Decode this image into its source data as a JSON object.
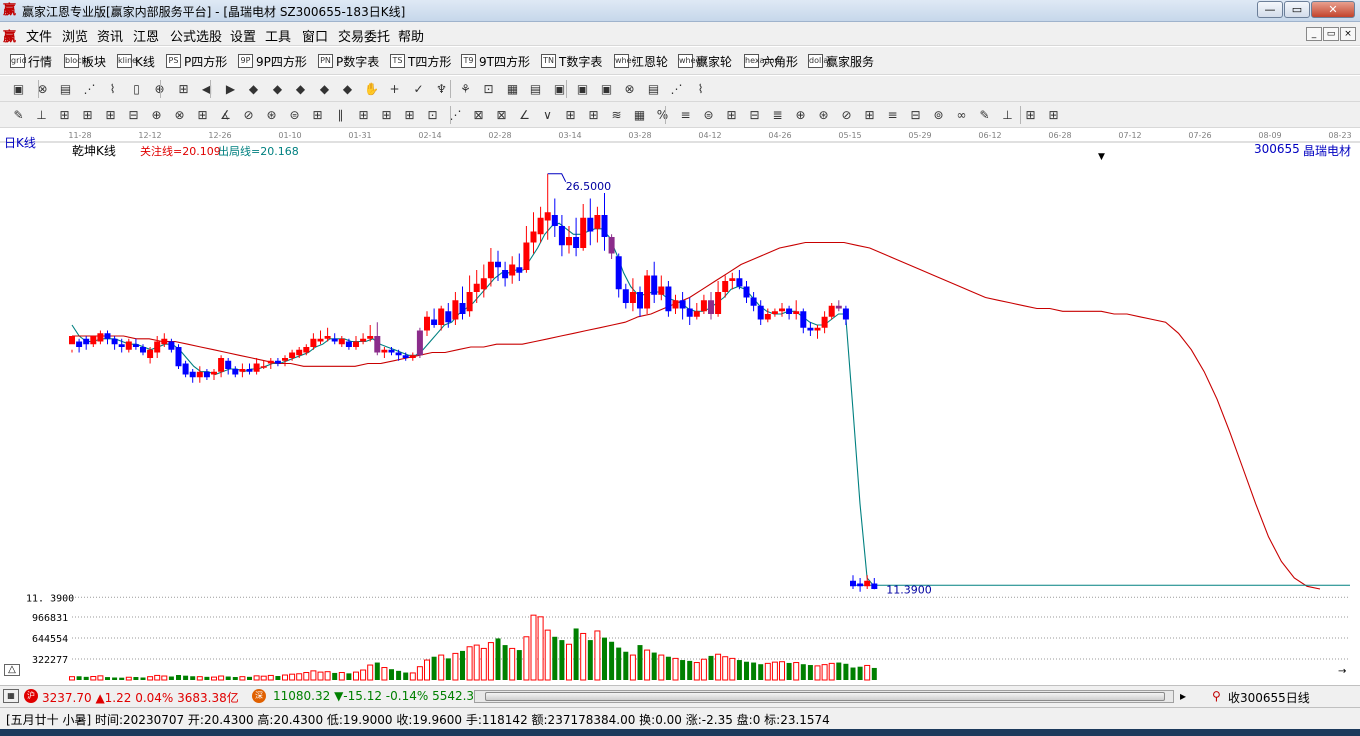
{
  "window": {
    "title": "赢家江恩专业版[赢家内部服务平台] - [晶瑞电材  SZ300655-183日K线]",
    "icon": "ying-app-icon",
    "app_icon_char": "赢",
    "min": "—",
    "restore": "▭",
    "close": "✕"
  },
  "menubar": {
    "items": [
      "文件",
      "浏览",
      "资讯",
      "江恩",
      "公式选股",
      "设置",
      "工具",
      "窗口",
      "交易委托",
      "帮助"
    ],
    "mdi": [
      "_",
      "▭",
      "×"
    ]
  },
  "toolbar1": {
    "items": [
      {
        "label": "行情",
        "icon": "grid"
      },
      {
        "label": "板块",
        "icon": "blocks"
      },
      {
        "label": "K线",
        "icon": "kline"
      },
      {
        "label": "P四方形",
        "icon": "PS"
      },
      {
        "label": "9P四方形",
        "icon": "9P"
      },
      {
        "label": "P数字表",
        "icon": "PN"
      },
      {
        "label": "T四方形",
        "icon": "TS"
      },
      {
        "label": "9T四方形",
        "icon": "T9"
      },
      {
        "label": "T数字表",
        "icon": "TN"
      },
      {
        "label": "江恩轮",
        "icon": "wheel"
      },
      {
        "label": "赢家轮",
        "icon": "wheel2"
      },
      {
        "label": "六角形",
        "icon": "hexagon"
      },
      {
        "label": "赢家服务",
        "icon": "dollar"
      }
    ]
  },
  "chart_header": {
    "period": "日K线",
    "indicator": "乾坤K线",
    "guan_zhu": "关注线=20.109",
    "chu_ju": "出局线=20.168",
    "code": "300655",
    "name": "晶瑞电材"
  },
  "date_axis": [
    "11-28",
    "12-12",
    "12-26",
    "01-10",
    "01-31",
    "02-14",
    "02-28",
    "03-14",
    "03-28",
    "04-12",
    "04-26",
    "05-15",
    "05-29",
    "06-12",
    "06-28",
    "07-12",
    "07-26",
    "08-09",
    "08-23"
  ],
  "price_labels": {
    "high": "26.5000",
    "low": "11.3900",
    "left_low": "11. 3900"
  },
  "volume_axis": [
    "966831",
    "644554",
    "322277"
  ],
  "colors": {
    "up": "#ff0000",
    "down": "#0000ff",
    "special": "#8b2c8b",
    "ma_fast": "#008080",
    "ma_slow": "#c80000",
    "vol_up": "#ff0000",
    "vol_down": "#008000"
  },
  "chart_data": {
    "type": "candlestick",
    "title": "乾坤K线",
    "ylim": [
      11.0,
      27.0
    ],
    "candles": [
      [
        20.3,
        20.6,
        20.1,
        20.0
      ],
      [
        20.4,
        20.2,
        20.0,
        20.5
      ],
      [
        20.5,
        20.3,
        20.1,
        20.6
      ],
      [
        20.3,
        20.6,
        20.2,
        20.6
      ],
      [
        20.4,
        20.7,
        20.3,
        20.8
      ],
      [
        20.7,
        20.5,
        20.3,
        20.8
      ],
      [
        20.5,
        20.3,
        20.1,
        20.6
      ],
      [
        20.3,
        20.2,
        20.0,
        20.5
      ],
      [
        20.1,
        20.4,
        20.0,
        20.5
      ],
      [
        20.3,
        20.2,
        20.1,
        20.5
      ],
      [
        20.2,
        20.0,
        19.9,
        20.3
      ],
      [
        19.8,
        20.1,
        19.6,
        20.2
      ],
      [
        20.0,
        20.4,
        19.8,
        20.6
      ],
      [
        20.3,
        20.5,
        20.2,
        20.7
      ],
      [
        20.4,
        20.1,
        20.0,
        20.5
      ],
      [
        20.2,
        19.5,
        19.4,
        20.3
      ],
      [
        19.6,
        19.2,
        19.1,
        19.7
      ],
      [
        19.3,
        19.1,
        18.9,
        19.4
      ],
      [
        19.1,
        19.3,
        18.9,
        19.5
      ],
      [
        19.3,
        19.1,
        19.0,
        19.4
      ],
      [
        19.2,
        19.3,
        19.0,
        19.4
      ],
      [
        19.3,
        19.8,
        19.1,
        19.9
      ],
      [
        19.7,
        19.4,
        19.2,
        19.8
      ],
      [
        19.4,
        19.2,
        19.1,
        19.5
      ],
      [
        19.3,
        19.4,
        19.1,
        19.6
      ],
      [
        19.4,
        19.3,
        19.2,
        19.6
      ],
      [
        19.3,
        19.6,
        19.2,
        19.8
      ],
      [
        19.5,
        19.5,
        19.4,
        19.7
      ],
      [
        19.6,
        19.7,
        19.4,
        19.8
      ],
      [
        19.7,
        19.6,
        19.5,
        19.8
      ],
      [
        19.7,
        19.8,
        19.5,
        19.9
      ],
      [
        19.8,
        20.0,
        19.7,
        20.1
      ],
      [
        19.9,
        20.1,
        19.8,
        20.2
      ],
      [
        20.0,
        20.2,
        19.9,
        20.3
      ],
      [
        20.2,
        20.5,
        20.1,
        20.7
      ],
      [
        20.4,
        20.5,
        20.3,
        20.8
      ],
      [
        20.5,
        20.6,
        20.4,
        20.9
      ],
      [
        20.5,
        20.4,
        20.3,
        20.7
      ],
      [
        20.3,
        20.5,
        20.2,
        20.6
      ],
      [
        20.4,
        20.2,
        20.1,
        20.5
      ],
      [
        20.2,
        20.4,
        20.1,
        20.6
      ],
      [
        20.4,
        20.5,
        20.3,
        20.7
      ],
      [
        20.5,
        20.6,
        20.4,
        21.0
      ],
      [
        20.6,
        20.0,
        19.9,
        21.1
      ],
      [
        20.0,
        20.1,
        19.8,
        20.2
      ],
      [
        20.1,
        20.0,
        19.9,
        20.2
      ],
      [
        20.0,
        19.9,
        19.7,
        20.1
      ],
      [
        19.9,
        19.8,
        19.7,
        20.0
      ],
      [
        19.8,
        19.9,
        19.7,
        20.0
      ],
      [
        19.9,
        20.8,
        19.8,
        20.9
      ],
      [
        20.8,
        21.3,
        20.6,
        21.5
      ],
      [
        21.2,
        21.0,
        20.9,
        21.6
      ],
      [
        21.0,
        21.6,
        20.8,
        21.7
      ],
      [
        21.5,
        21.1,
        20.9,
        21.8
      ],
      [
        21.2,
        21.9,
        21.0,
        22.2
      ],
      [
        21.8,
        21.4,
        21.2,
        22.4
      ],
      [
        21.5,
        22.2,
        21.3,
        22.8
      ],
      [
        22.2,
        22.5,
        21.8,
        23.0
      ],
      [
        22.3,
        22.7,
        22.0,
        23.2
      ],
      [
        22.7,
        23.3,
        22.4,
        23.8
      ],
      [
        23.3,
        23.1,
        22.6,
        23.7
      ],
      [
        23.0,
        22.7,
        22.4,
        23.3
      ],
      [
        22.8,
        23.2,
        22.5,
        23.5
      ],
      [
        23.1,
        22.9,
        22.6,
        23.6
      ],
      [
        23.0,
        24.0,
        22.9,
        24.6
      ],
      [
        24.0,
        24.4,
        23.6,
        25.1
      ],
      [
        24.3,
        24.9,
        24.0,
        25.3
      ],
      [
        24.8,
        25.1,
        24.1,
        26.5
      ],
      [
        25.0,
        24.6,
        24.2,
        25.6
      ],
      [
        24.6,
        23.9,
        23.5,
        25.0
      ],
      [
        23.9,
        24.2,
        23.6,
        24.6
      ],
      [
        24.2,
        23.8,
        23.5,
        24.9
      ],
      [
        23.8,
        24.9,
        23.7,
        25.4
      ],
      [
        24.9,
        24.4,
        23.9,
        25.6
      ],
      [
        24.5,
        25.0,
        24.0,
        25.3
      ],
      [
        25.0,
        24.2,
        23.7,
        25.8
      ],
      [
        24.2,
        23.6,
        23.4,
        24.3
      ],
      [
        23.5,
        22.3,
        22.0,
        23.6
      ],
      [
        22.3,
        21.8,
        21.6,
        22.5
      ],
      [
        21.8,
        22.2,
        21.5,
        22.7
      ],
      [
        22.2,
        21.6,
        21.3,
        22.4
      ],
      [
        21.6,
        22.8,
        21.4,
        23.0
      ],
      [
        22.8,
        22.1,
        21.8,
        23.3
      ],
      [
        22.1,
        22.4,
        21.9,
        22.8
      ],
      [
        22.4,
        21.5,
        21.3,
        22.6
      ],
      [
        21.6,
        21.9,
        21.4,
        22.1
      ],
      [
        21.9,
        21.6,
        21.2,
        22.2
      ],
      [
        21.6,
        21.3,
        21.0,
        22.0
      ],
      [
        21.3,
        21.5,
        21.2,
        21.8
      ],
      [
        21.5,
        21.9,
        21.4,
        22.1
      ],
      [
        21.9,
        21.4,
        21.2,
        22.2
      ],
      [
        21.4,
        22.2,
        21.3,
        22.6
      ],
      [
        22.2,
        22.6,
        22.0,
        22.8
      ],
      [
        22.6,
        22.7,
        22.3,
        22.9
      ],
      [
        22.7,
        22.4,
        22.3,
        23.0
      ],
      [
        22.4,
        22.0,
        21.8,
        22.6
      ],
      [
        22.0,
        21.7,
        21.5,
        22.2
      ],
      [
        21.7,
        21.2,
        21.0,
        21.9
      ],
      [
        21.2,
        21.4,
        21.1,
        21.6
      ],
      [
        21.4,
        21.5,
        21.3,
        21.6
      ],
      [
        21.5,
        21.6,
        21.3,
        21.8
      ],
      [
        21.6,
        21.4,
        21.2,
        21.7
      ],
      [
        21.4,
        21.5,
        21.2,
        21.9
      ],
      [
        21.5,
        20.9,
        20.7,
        21.6
      ],
      [
        20.9,
        20.8,
        20.6,
        21.1
      ],
      [
        20.8,
        20.9,
        20.5,
        21.0
      ],
      [
        20.9,
        21.3,
        20.7,
        21.5
      ],
      [
        21.3,
        21.7,
        21.2,
        21.8
      ],
      [
        21.7,
        21.6,
        21.5,
        21.9
      ],
      [
        21.6,
        21.2,
        21.0,
        21.7
      ],
      [
        11.7,
        11.5,
        11.4,
        11.9
      ],
      [
        11.6,
        11.5,
        11.3,
        11.8
      ],
      [
        11.5,
        11.7,
        11.4,
        11.9
      ],
      [
        11.6,
        11.4,
        11.39,
        11.8
      ]
    ],
    "ma_fast": [
      21.0,
      20.6,
      20.4,
      20.4,
      20.5,
      20.5,
      20.5,
      20.4,
      20.3,
      20.3,
      20.2,
      20.1,
      20.2,
      20.3,
      20.3,
      20.1,
      19.8,
      19.5,
      19.3,
      19.3,
      19.2,
      19.3,
      19.4,
      19.4,
      19.3,
      19.4,
      19.4,
      19.5,
      19.6,
      19.6,
      19.7,
      19.8,
      19.9,
      20.0,
      20.2,
      20.3,
      20.5,
      20.5,
      20.5,
      20.4,
      20.4,
      20.4,
      20.5,
      20.3,
      20.2,
      20.1,
      20.0,
      19.9,
      19.9,
      20.1,
      20.4,
      20.7,
      21.0,
      21.1,
      21.4,
      21.6,
      21.8,
      22.1,
      22.4,
      22.7,
      22.9,
      22.9,
      23.0,
      23.0,
      23.4,
      23.8,
      24.3,
      24.6,
      24.7,
      24.5,
      24.3,
      24.3,
      24.4,
      24.5,
      24.5,
      24.2,
      23.6,
      22.9,
      22.4,
      22.1,
      22.1,
      22.2,
      22.2,
      22.0,
      21.9,
      21.8,
      21.6,
      21.5,
      21.5,
      21.6,
      21.8,
      22.0,
      22.3,
      22.4,
      22.3,
      22.0,
      21.7,
      21.5,
      21.4,
      21.4,
      21.5,
      21.5,
      21.3,
      21.1,
      21.0,
      21.0,
      21.2,
      21.4,
      21.4,
      18.0,
      14.5,
      11.8,
      11.5
    ],
    "ma_slow": [
      20.6,
      20.6,
      20.6,
      20.6,
      20.6,
      20.5,
      20.5,
      20.4,
      20.4,
      20.3,
      20.2,
      20.1,
      20.0,
      19.9,
      19.8,
      19.7,
      19.6,
      19.6,
      19.5,
      19.5,
      19.5,
      19.5,
      19.5,
      19.6,
      19.6,
      19.7,
      19.8,
      19.9,
      20.0,
      20.0,
      20.1,
      20.2,
      20.2,
      20.3,
      20.3,
      20.3,
      20.4,
      20.5,
      20.6,
      20.7,
      20.8,
      20.9,
      21.0,
      21.1,
      21.3,
      21.4,
      21.6,
      21.8,
      22.0,
      22.3,
      22.6,
      22.9,
      23.2,
      23.4,
      23.6,
      23.8,
      23.9,
      24.0,
      24.0,
      24.0,
      24.0,
      23.9,
      23.8,
      23.6,
      23.4,
      23.2,
      23.0,
      22.8,
      22.6,
      22.4,
      22.2,
      22.0,
      21.9,
      21.8,
      21.7,
      21.6,
      21.6,
      21.5,
      21.5,
      21.5,
      21.5,
      21.4,
      21.4,
      21.3,
      21.2,
      21.1,
      20.7,
      20.1,
      19.3,
      18.3,
      17.1,
      15.8,
      14.5,
      13.3,
      12.4,
      11.8,
      11.5,
      11.4
    ],
    "volume": [
      40,
      45,
      38,
      42,
      50,
      35,
      30,
      28,
      33,
      36,
      30,
      40,
      55,
      48,
      42,
      60,
      52,
      45,
      40,
      38,
      35,
      48,
      42,
      36,
      40,
      38,
      50,
      46,
      55,
      48,
      60,
      70,
      75,
      90,
      110,
      95,
      100,
      85,
      90,
      80,
      95,
      120,
      180,
      210,
      150,
      130,
      110,
      90,
      85,
      160,
      240,
      280,
      300,
      260,
      320,
      350,
      400,
      420,
      380,
      450,
      500,
      420,
      380,
      360,
      520,
      780,
      760,
      600,
      520,
      480,
      430,
      620,
      560,
      480,
      590,
      510,
      460,
      390,
      340,
      300,
      420,
      360,
      330,
      300,
      280,
      260,
      240,
      230,
      210,
      250,
      290,
      310,
      280,
      260,
      240,
      220,
      210,
      190,
      200,
      215,
      220,
      205,
      210,
      190,
      180,
      170,
      185,
      200,
      210,
      195,
      150,
      160,
      175,
      145
    ],
    "volume_max": 966831
  }
}
